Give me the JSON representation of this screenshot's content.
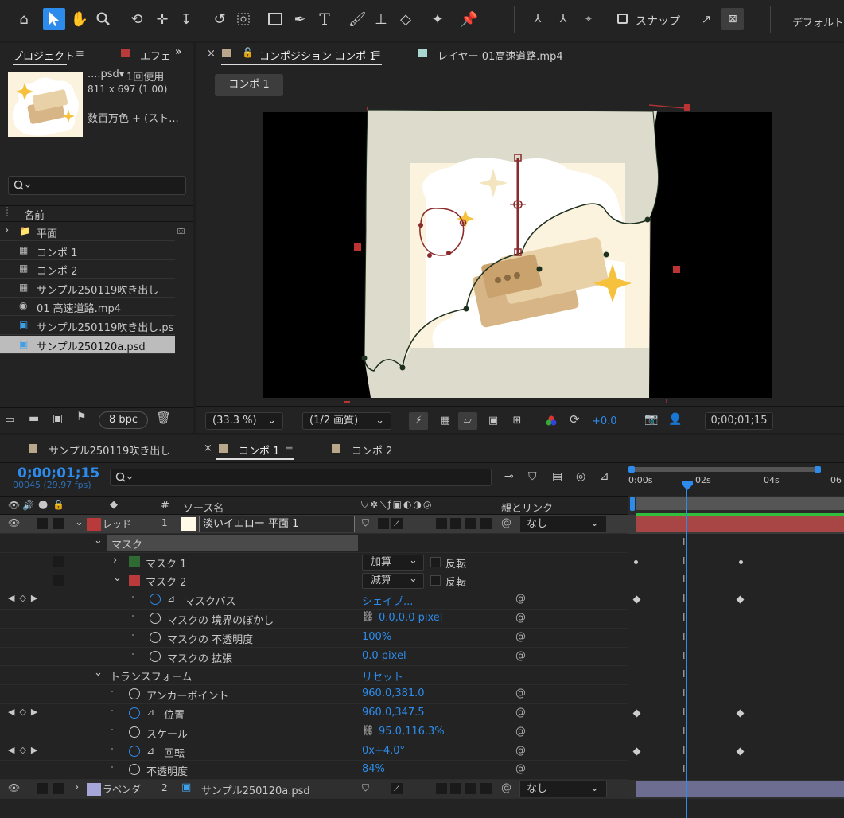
{
  "toolbar": {
    "snap_label": "スナップ",
    "workspace_label": "デフォルト"
  },
  "project": {
    "tab_label": "プロジェクト",
    "effects_tab_label": "エフェ",
    "item_name": "....psd▾",
    "item_usage": "1回使用",
    "item_dims": "811 x 697 (1.00)",
    "item_colors": "数百万色 + (スト...",
    "col_name": "名前",
    "items": [
      {
        "name": "平面",
        "type": "folder"
      },
      {
        "name": "コンポ 1",
        "type": "comp"
      },
      {
        "name": "コンポ 2",
        "type": "comp"
      },
      {
        "name": "サンプル250119吹き出し",
        "type": "comp"
      },
      {
        "name": "01 高速道路.mp4",
        "type": "video"
      },
      {
        "name": "サンプル250119吹き出し.ps",
        "type": "psd"
      },
      {
        "name": "サンプル250120a.psd",
        "type": "psd"
      }
    ],
    "bpc_label": "8 bpc"
  },
  "viewer": {
    "comp_tab_label": "コンポジション コンポ 1",
    "layer_tab_label": "レイヤー 01高速道路.mp4",
    "breadcrumb": "コンポ 1",
    "zoom": "(33.3 %)",
    "quality": "(1/2 画質)",
    "exposure": "+0.0",
    "timecode": "0;00;01;15"
  },
  "timeline": {
    "tabs": [
      "サンプル250119吹き出し",
      "コンポ 1",
      "コンポ 2"
    ],
    "timecode": "0;00;01;15",
    "frame_info": "00045 (29.97 fps)",
    "col_hash": "#",
    "col_source": "ソース名",
    "col_parent": "親とリンク",
    "ruler": [
      "0:00s",
      "02s",
      "04s",
      "06"
    ],
    "layer1": {
      "label": "レッド",
      "num": "1",
      "name": "淡いイエロー 平面 1",
      "parent": "なし"
    },
    "mask_group": "マスク",
    "mask1": {
      "name": "マスク 1",
      "mode": "加算",
      "invert": "反転"
    },
    "mask2": {
      "name": "マスク 2",
      "mode": "減算",
      "invert": "反転"
    },
    "mask_path": {
      "label": "マスクパス",
      "value": "シェイプ..."
    },
    "mask_feather": {
      "label": "マスクの 境界のぼかし",
      "value": "0.0,0.0 pixel"
    },
    "mask_opacity": {
      "label": "マスクの 不透明度",
      "value": "100%"
    },
    "mask_expansion": {
      "label": "マスクの 拡張",
      "value": "0.0 pixel"
    },
    "transform": {
      "label": "トランスフォーム",
      "value": "リセット"
    },
    "anchor": {
      "label": "アンカーポイント",
      "value": "960.0,381.0"
    },
    "position": {
      "label": "位置",
      "value": "960.0,347.5"
    },
    "scale": {
      "label": "スケール",
      "value": "95.0,116.3%"
    },
    "rotation": {
      "label": "回転",
      "value": "0x+4.0°"
    },
    "opacity": {
      "label": "不透明度",
      "value": "84%"
    },
    "layer2": {
      "label": "ラベンダ",
      "num": "2",
      "name": "サンプル250120a.psd",
      "parent": "なし"
    }
  },
  "colors": {
    "accent": "#2d8ceb",
    "red_label": "#b83a3a",
    "lavender_label": "#a6a6d8",
    "green_mask": "#2f6a35",
    "timeline_bar_red": "#a84545",
    "timeline_bar_lavender": "#6d6d91"
  }
}
